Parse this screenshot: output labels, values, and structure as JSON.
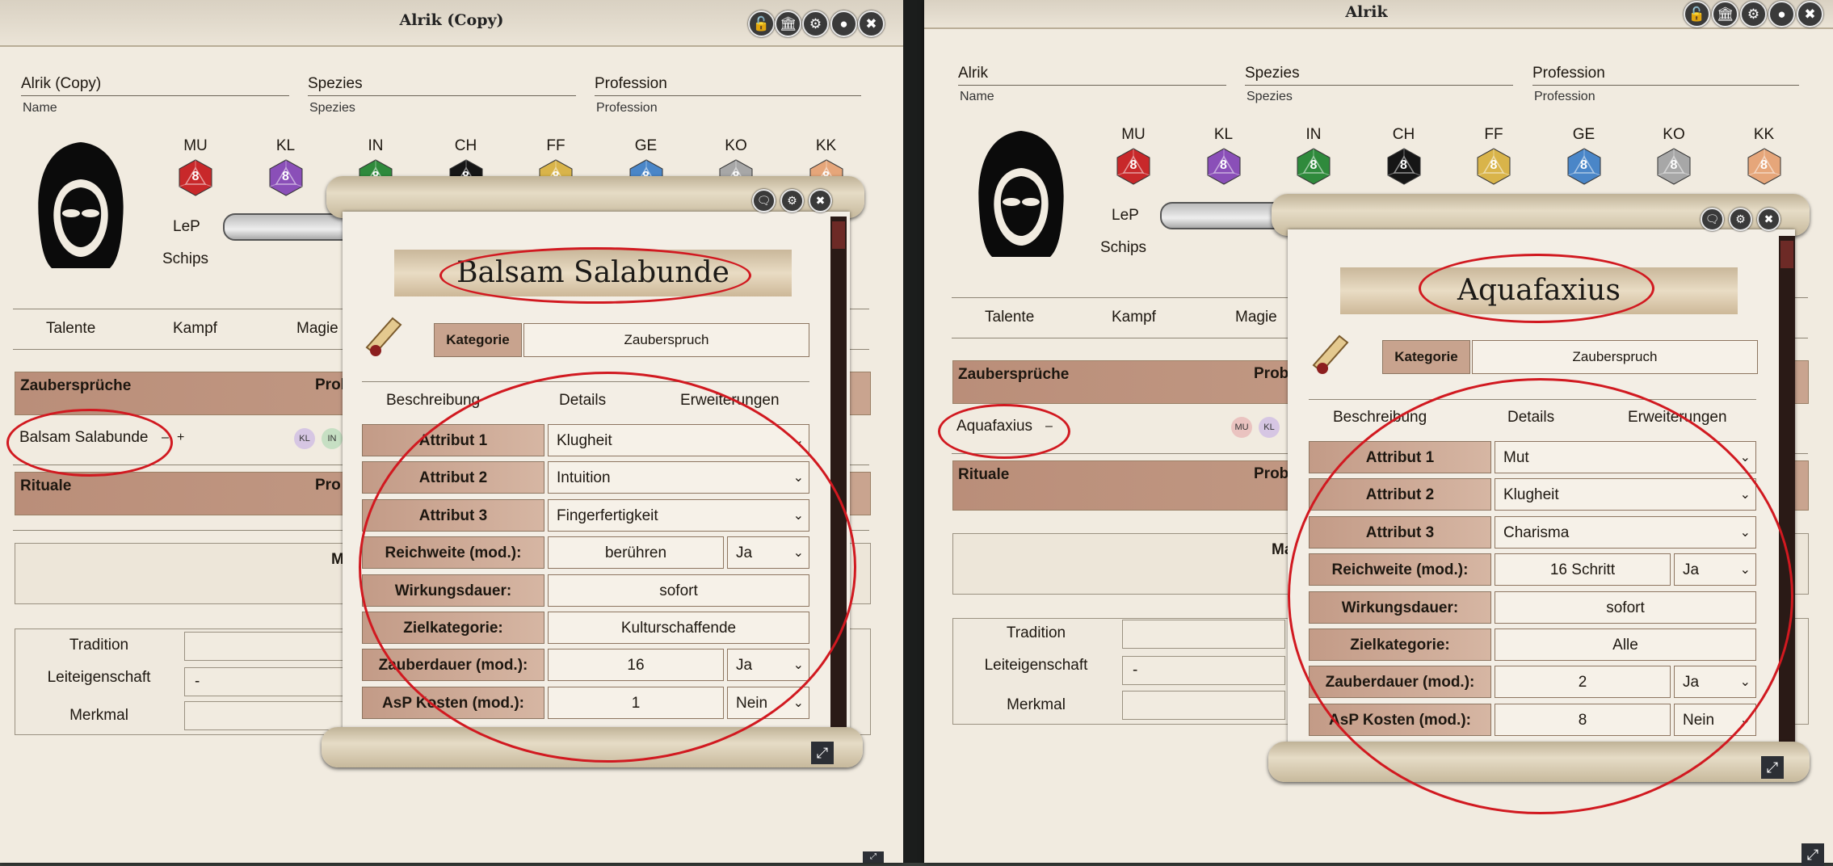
{
  "left": {
    "title": "Alrik (Copy)",
    "name_value": "Alrik (Copy)",
    "name_label": "Name",
    "species_value": "Spezies",
    "species_label": "Spezies",
    "profession_value": "Profession",
    "profession_label": "Profession",
    "attributes": [
      {
        "label": "MU",
        "value": "8",
        "color": "#c8282a"
      },
      {
        "label": "KL",
        "value": "8",
        "color": "#8a4fb8"
      },
      {
        "label": "IN",
        "value": "8",
        "color": "#2f8a3c"
      },
      {
        "label": "CH",
        "value": "8",
        "color": "#161616"
      },
      {
        "label": "FF",
        "value": "8",
        "color": "#d9b44a"
      },
      {
        "label": "GE",
        "value": "8",
        "color": "#4a86c8"
      },
      {
        "label": "KO",
        "value": "8",
        "color": "#a7a7a7"
      },
      {
        "label": "KK",
        "value": "8",
        "color": "#e6a67a"
      }
    ],
    "lep_label": "LeP",
    "schips_label": "Schips",
    "tabs": [
      "Talente",
      "Kampf",
      "Magie"
    ],
    "spells_header": "Zaubersprüche",
    "spells_header_right": "Prob",
    "spell_name": "Balsam Salabunde",
    "spell_minus": "–",
    "spell_plus": "+",
    "spell_badges": [
      "KL",
      "IN"
    ],
    "rituals_header": "Rituale",
    "rituals_header_right": "Pro",
    "m_label": "M",
    "tradition_label": "Tradition",
    "leiteigenschaft_label": "Leiteigenschaft",
    "leiteigenschaft_value": "-",
    "merkmal_label": "Merkmal"
  },
  "right": {
    "title": "Alrik",
    "name_value": "Alrik",
    "name_label": "Name",
    "species_value": "Spezies",
    "species_label": "Spezies",
    "profession_value": "Profession",
    "profession_label": "Profession",
    "attributes": [
      {
        "label": "MU",
        "value": "8",
        "color": "#c8282a"
      },
      {
        "label": "KL",
        "value": "8",
        "color": "#8a4fb8"
      },
      {
        "label": "IN",
        "value": "8",
        "color": "#2f8a3c"
      },
      {
        "label": "CH",
        "value": "8",
        "color": "#161616"
      },
      {
        "label": "FF",
        "value": "8",
        "color": "#d9b44a"
      },
      {
        "label": "GE",
        "value": "8",
        "color": "#4a86c8"
      },
      {
        "label": "KO",
        "value": "8",
        "color": "#a7a7a7"
      },
      {
        "label": "KK",
        "value": "8",
        "color": "#e6a67a"
      }
    ],
    "lep_label": "LeP",
    "schips_label": "Schips",
    "tabs": [
      "Talente",
      "Kampf",
      "Magie"
    ],
    "spells_header": "Zaubersprüche",
    "spells_header_right": "Probe",
    "spell_name": "Aquafaxius",
    "spell_minus": "–",
    "spell_badges": [
      "MU",
      "KL"
    ],
    "rituals_header": "Rituale",
    "rituals_header_right": "Prob",
    "m_label": "Ma",
    "tradition_label": "Tradition",
    "leiteigenschaft_label": "Leiteigenschaft",
    "leiteigenschaft_value": "-",
    "merkmal_label": "Merkmal"
  },
  "popup_left": {
    "title": "Balsam Salabunde",
    "kategorie_label": "Kategorie",
    "kategorie_value": "Zauberspruch",
    "tabs": [
      "Beschreibung",
      "Details",
      "Erweiterungen"
    ],
    "rows": [
      {
        "label": "Attribut 1",
        "value": "Klugheit",
        "kind": "select"
      },
      {
        "label": "Attribut 2",
        "value": "Intuition",
        "kind": "select"
      },
      {
        "label": "Attribut 3",
        "value": "Fingerfertigkeit",
        "kind": "select"
      },
      {
        "label": "Reichweite (mod.):",
        "value": "berühren",
        "mod": "Ja",
        "kind": "mod"
      },
      {
        "label": "Wirkungsdauer:",
        "value": "sofort",
        "kind": "text"
      },
      {
        "label": "Zielkategorie:",
        "value": "Kulturschaffende",
        "kind": "text"
      },
      {
        "label": "Zauberdauer (mod.):",
        "value": "16",
        "mod": "Ja",
        "kind": "mod"
      },
      {
        "label": "AsP Kosten (mod.):",
        "value": "1",
        "mod": "Nein",
        "kind": "mod"
      }
    ]
  },
  "popup_right": {
    "title": "Aquafaxius",
    "kategorie_label": "Kategorie",
    "kategorie_value": "Zauberspruch",
    "tabs": [
      "Beschreibung",
      "Details",
      "Erweiterungen"
    ],
    "rows": [
      {
        "label": "Attribut 1",
        "value": "Mut",
        "kind": "select"
      },
      {
        "label": "Attribut 2",
        "value": "Klugheit",
        "kind": "select"
      },
      {
        "label": "Attribut 3",
        "value": "Charisma",
        "kind": "select"
      },
      {
        "label": "Reichweite (mod.):",
        "value": "16 Schritt",
        "mod": "Ja",
        "kind": "mod"
      },
      {
        "label": "Wirkungsdauer:",
        "value": "sofort",
        "kind": "text"
      },
      {
        "label": "Zielkategorie:",
        "value": "Alle",
        "kind": "text"
      },
      {
        "label": "Zauberdauer (mod.):",
        "value": "2",
        "mod": "Ja",
        "kind": "mod"
      },
      {
        "label": "AsP Kosten (mod.):",
        "value": "8",
        "mod": "Nein",
        "kind": "mod"
      }
    ]
  },
  "icons": {
    "lock": "lock-icon",
    "temple": "temple-icon",
    "gear": "gear-icon",
    "user": "user-icon",
    "close": "close-icon",
    "chat": "chat-icon",
    "resize": "resize-icon",
    "chevron": "chevron-down-icon"
  }
}
